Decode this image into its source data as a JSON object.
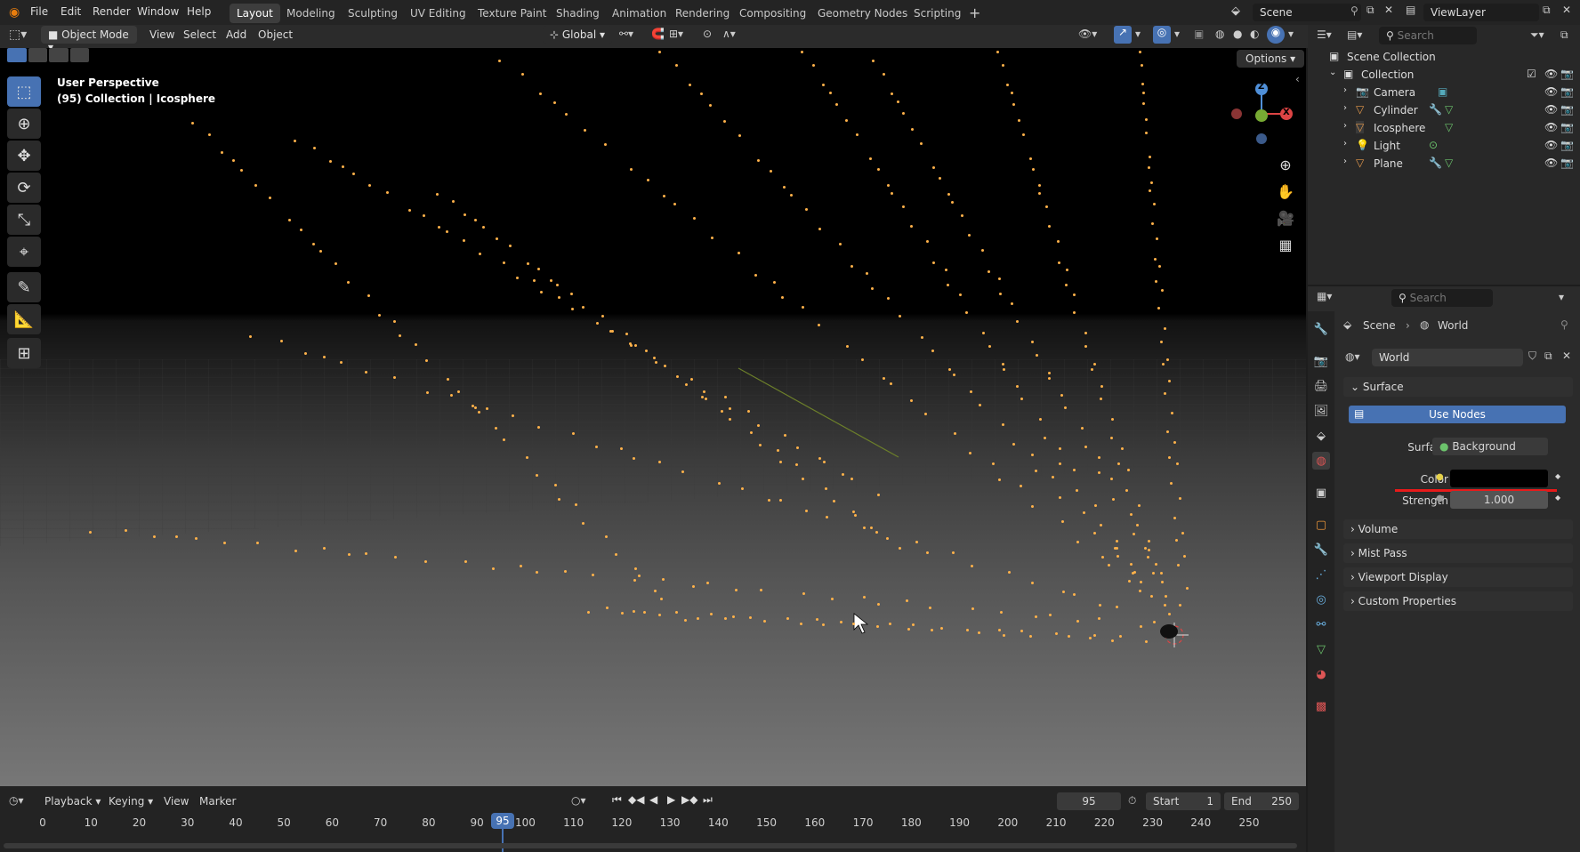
{
  "menu": [
    "File",
    "Edit",
    "Render",
    "Window",
    "Help"
  ],
  "workspaces": [
    "Layout",
    "Modeling",
    "Sculpting",
    "UV Editing",
    "Texture Paint",
    "Shading",
    "Animation",
    "Rendering",
    "Compositing",
    "Geometry Nodes",
    "Scripting"
  ],
  "active_workspace": "Layout",
  "scene_name": "Scene",
  "view_layer": "ViewLayer",
  "header": {
    "mode": "Object Mode",
    "view": "View",
    "select": "Select",
    "add": "Add",
    "object": "Object",
    "transform": "Global",
    "options": "Options"
  },
  "viewport": {
    "perspective": "User Perspective",
    "collection_info": "(95) Collection | Icosphere",
    "gizmo": {
      "z": "Z",
      "x": "X"
    }
  },
  "outliner": {
    "search_placeholder": "Search",
    "root": "Scene Collection",
    "collection": "Collection",
    "items": [
      "Camera",
      "Cylinder",
      "Icosphere",
      "Light",
      "Plane"
    ]
  },
  "properties": {
    "search_placeholder": "Search",
    "breadcrumb": [
      "Scene",
      "World"
    ],
    "world_name": "World",
    "surface_panel": "Surface",
    "use_nodes": "Use Nodes",
    "surface_label": "Surface",
    "surface_value": "Background",
    "color_label": "Color",
    "color_value": "#000000",
    "strength_label": "Strength",
    "strength_value": "1.000",
    "panels": [
      "Volume",
      "Mist Pass",
      "Viewport Display",
      "Custom Properties"
    ]
  },
  "timeline": {
    "playback": "Playback",
    "keying": "Keying",
    "view": "View",
    "marker": "Marker",
    "current_frame": "95",
    "start_label": "Start",
    "start": "1",
    "end_label": "End",
    "end": "250",
    "ticks": [
      "0",
      "10",
      "20",
      "30",
      "40",
      "50",
      "60",
      "70",
      "80",
      "90",
      "100",
      "110",
      "120",
      "130",
      "140",
      "150",
      "160",
      "170",
      "180",
      "190",
      "200",
      "210",
      "220",
      "230",
      "240",
      "250"
    ],
    "playhead_label": "95"
  }
}
